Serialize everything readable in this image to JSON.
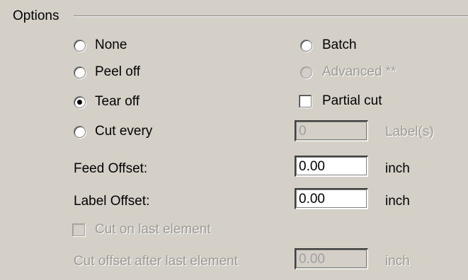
{
  "options": {
    "title": "Options",
    "radios": {
      "none": "None",
      "batch": "Batch",
      "peel_off": "Peel off",
      "advanced": "Advanced **",
      "tear_off": "Tear off",
      "cut_every": "Cut every"
    },
    "selected": "tear_off",
    "partial_cut_label": "Partial cut",
    "cut_every_value": "0",
    "cut_every_unit": "Label(s)",
    "feed_offset": {
      "label": "Feed Offset:",
      "value": "0.00",
      "unit": "inch"
    },
    "label_offset": {
      "label": "Label Offset:",
      "value": "0.00",
      "unit": "inch"
    },
    "cut_on_last_label": "Cut on last element",
    "cut_offset_after_last": {
      "label": "Cut offset after last element",
      "value": "0.00",
      "unit": "inch"
    }
  }
}
